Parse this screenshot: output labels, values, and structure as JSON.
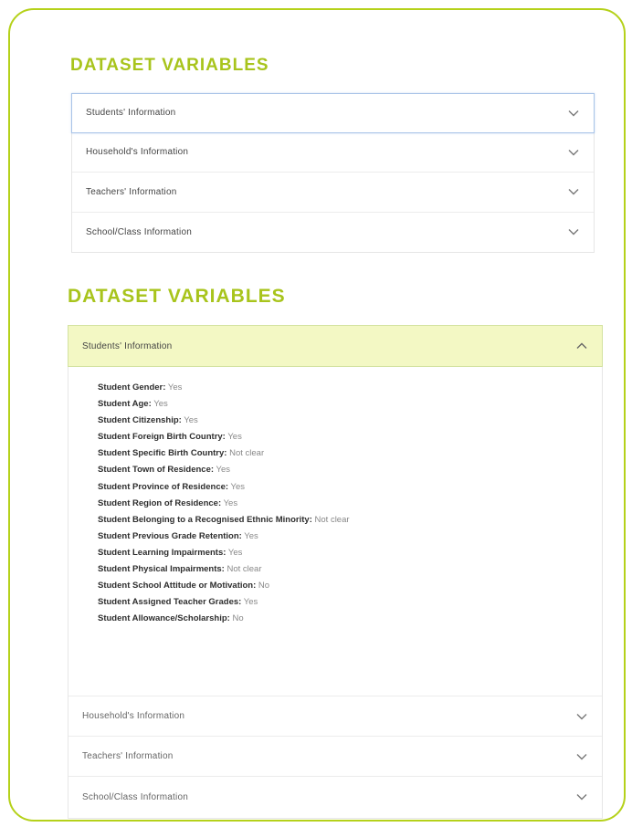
{
  "section1": {
    "title": "DATASET VARIABLES",
    "items": [
      {
        "label": "Students' Information"
      },
      {
        "label": "Household's Information"
      },
      {
        "label": "Teachers' Information"
      },
      {
        "label": "School/Class Information"
      }
    ]
  },
  "section2": {
    "title": "DATASET VARIABLES",
    "open_item": {
      "label": "Students' Information"
    },
    "variables": [
      {
        "name": "Student Gender:",
        "value": "Yes"
      },
      {
        "name": "Student Age:",
        "value": "Yes"
      },
      {
        "name": "Student Citizenship:",
        "value": "Yes"
      },
      {
        "name": "Student Foreign Birth Country:",
        "value": "Yes"
      },
      {
        "name": "Student Specific Birth Country:",
        "value": "Not clear"
      },
      {
        "name": "Student Town of Residence:",
        "value": "Yes"
      },
      {
        "name": "Student Province of Residence:",
        "value": "Yes"
      },
      {
        "name": "Student Region of Residence:",
        "value": "Yes"
      },
      {
        "name": "Student Belonging to a Recognised Ethnic Minority:",
        "value": "Not clear"
      },
      {
        "name": "Student Previous Grade Retention:",
        "value": "Yes"
      },
      {
        "name": "Student Learning Impairments:",
        "value": "Yes"
      },
      {
        "name": "Student Physical Impairments:",
        "value": "Not clear"
      },
      {
        "name": "Student School Attitude or Motivation:",
        "value": "No"
      },
      {
        "name": "Student Assigned Teacher Grades:",
        "value": "Yes"
      },
      {
        "name": "Student Allowance/Scholarship:",
        "value": "No"
      }
    ],
    "items": [
      {
        "label": "Household's Information"
      },
      {
        "label": "Teachers' Information"
      },
      {
        "label": "School/Class Information"
      }
    ]
  },
  "colors": {
    "accent": "#a8c41c",
    "card_border": "#b5d11a",
    "open_header_bg": "#f3f8c4"
  },
  "icons": {
    "collapsed": "chevron-down-icon",
    "expanded": "chevron-up-icon"
  }
}
